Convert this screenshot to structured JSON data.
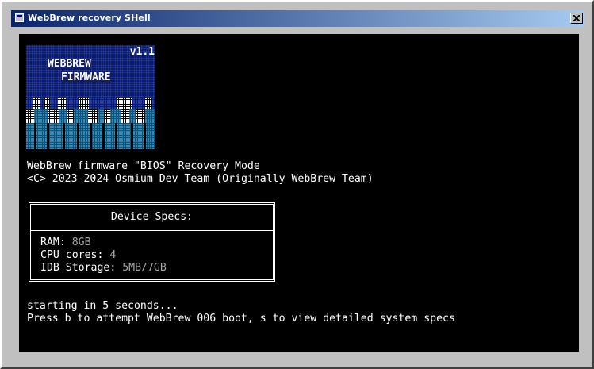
{
  "window": {
    "title": "WebBrew recovery SHell"
  },
  "logo": {
    "version": "v1.1",
    "line1": "WEBBREW",
    "line2": "FIRMWARE"
  },
  "header_lines": [
    "WebBrew firmware \"BIOS\" Recovery Mode",
    "<C> 2023-2024 Osmium Dev Team (Originally WebBrew Team)"
  ],
  "specs": {
    "title": "Device Specs:",
    "rows": [
      {
        "label": "RAM: ",
        "value": "8GB"
      },
      {
        "label": "CPU cores: ",
        "value": "4"
      },
      {
        "label": "IDB Storage: ",
        "value": "5MB/7GB"
      }
    ]
  },
  "footer_lines": [
    "starting in 5 seconds...",
    "Press b to attempt WebBrew 006 boot, s to view detailed system specs"
  ],
  "colors": {
    "screen_bg": "#000000",
    "text": "#ffffff",
    "muted_value": "#a8a8a8",
    "logo_dark_blue": "#101a58",
    "logo_blue": "#1f3dbb",
    "logo_cyan": "#2a8fb5",
    "titlebar_start": "#0a246a",
    "titlebar_end": "#a6caf0"
  },
  "icons": {
    "app": "window-app-icon",
    "close": "close-x-icon"
  }
}
